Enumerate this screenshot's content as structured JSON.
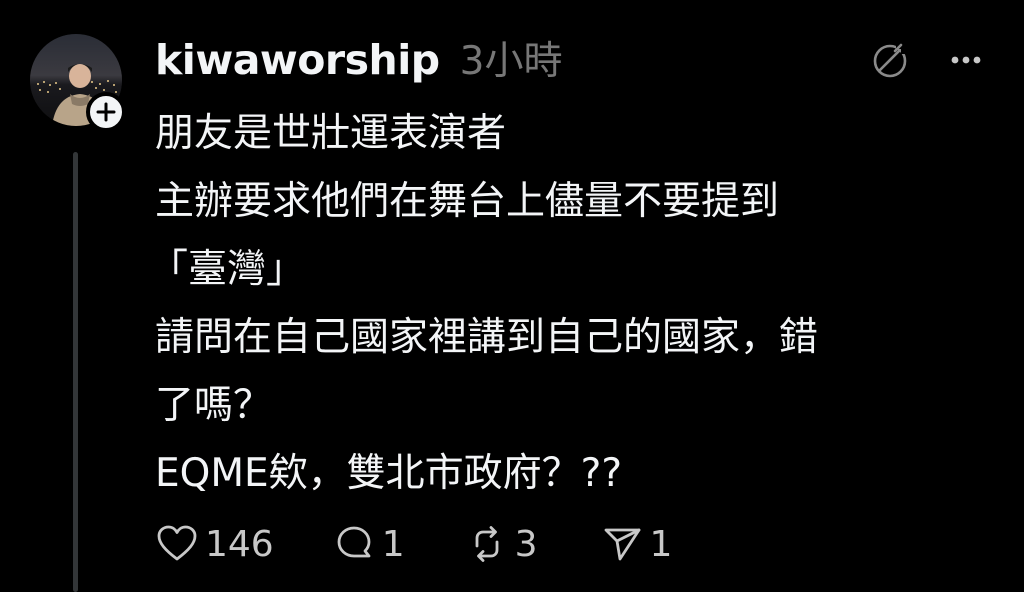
{
  "post": {
    "username": "kiwaworship",
    "timestamp": "3小時",
    "lines": [
      "朋友是世壯運表演者",
      "主辦要求他們在舞台上儘量不要提到",
      "「臺灣」",
      "請問在自己國家裡講到自己的國家，錯",
      "了嗎？",
      "EQME欸，雙北市政府？??"
    ]
  },
  "header_icons": {
    "translate": "translate-icon",
    "more": "more-icon"
  },
  "actions": {
    "likes": "146",
    "replies": "1",
    "reposts": "3",
    "shares": "1"
  },
  "colors": {
    "background": "#000000",
    "text": "#f3f5f7",
    "muted": "#777777",
    "thread_line": "#333638"
  }
}
